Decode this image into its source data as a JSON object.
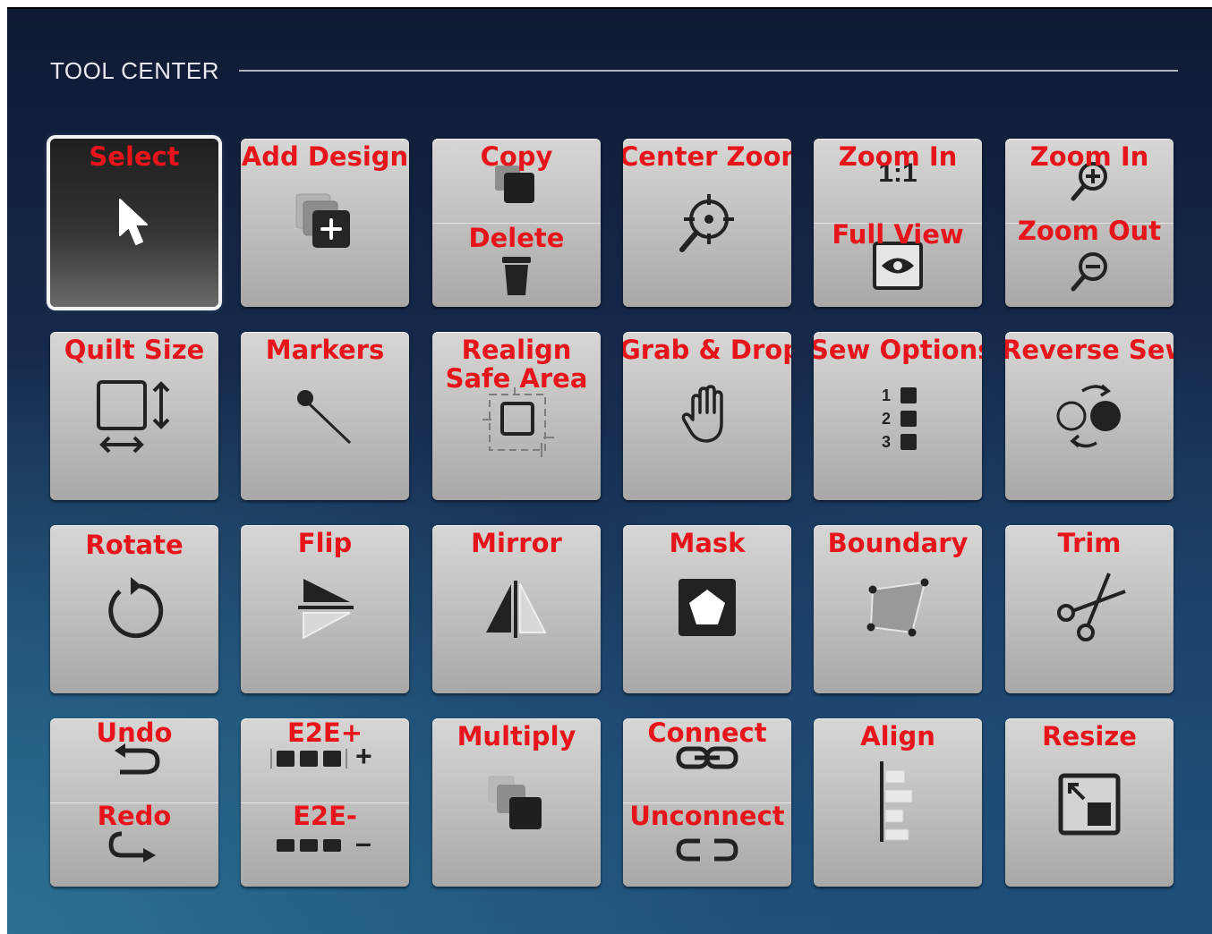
{
  "header": {
    "title": "TOOL CENTER"
  },
  "tools": {
    "select": {
      "label": "Select"
    },
    "add_design": {
      "label": "Add Design"
    },
    "copy": {
      "label": "Copy"
    },
    "delete": {
      "label": "Delete"
    },
    "center_zoom": {
      "label": "Center Zoom"
    },
    "zoom_1to1": {
      "label": "Zoom In",
      "glyph": "1:1"
    },
    "full_view": {
      "label": "Full View"
    },
    "zoom_in": {
      "label": "Zoom In"
    },
    "zoom_out": {
      "label": "Zoom Out"
    },
    "quilt_size": {
      "label": "Quilt Size"
    },
    "markers": {
      "label": "Markers"
    },
    "realign_safe_area": {
      "label": "Realign Safe Area"
    },
    "grab_drop": {
      "label": "Grab & Drop"
    },
    "sew_options": {
      "label": "Sew Options",
      "numbers": [
        "1",
        "2",
        "3"
      ]
    },
    "reverse_sew": {
      "label": "Reverse Sew"
    },
    "rotate": {
      "label": "Rotate"
    },
    "flip": {
      "label": "Flip"
    },
    "mirror": {
      "label": "Mirror"
    },
    "mask": {
      "label": "Mask"
    },
    "boundary": {
      "label": "Boundary"
    },
    "trim": {
      "label": "Trim"
    },
    "undo": {
      "label": "Undo"
    },
    "redo": {
      "label": "Redo"
    },
    "e2e_plus": {
      "label": "E2E+",
      "glyph": "+"
    },
    "e2e_minus": {
      "label": "E2E-",
      "glyph": "–"
    },
    "multiply": {
      "label": "Multiply"
    },
    "connect": {
      "label": "Connect"
    },
    "unconnect": {
      "label": "Unconnect"
    },
    "align": {
      "label": "Align"
    },
    "resize": {
      "label": "Resize"
    }
  },
  "colors": {
    "label": "#e8141b",
    "button": "#c3c2c0",
    "selected": "#2a2a2a"
  }
}
